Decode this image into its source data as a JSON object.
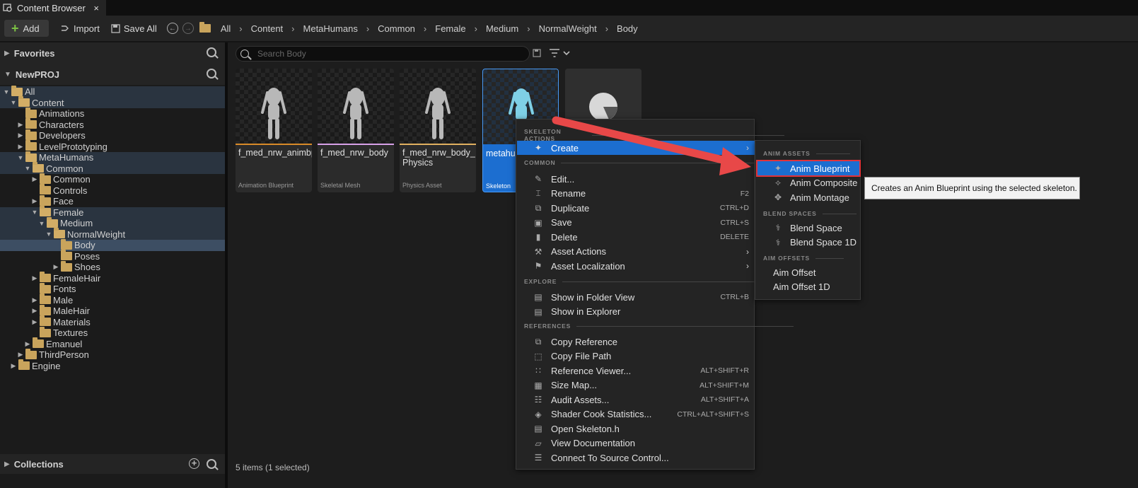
{
  "tab": {
    "title": "Content Browser",
    "close": "×"
  },
  "toolbar": {
    "add": "Add",
    "import": "Import",
    "save_all": "Save All",
    "breadcrumbs": [
      "All",
      "Content",
      "MetaHumans",
      "Common",
      "Female",
      "Medium",
      "NormalWeight",
      "Body"
    ]
  },
  "left": {
    "favorites": "Favorites",
    "project": "NewPROJ",
    "collections": "Collections",
    "tree": [
      {
        "label": "All",
        "indent": 0,
        "arrow": "down",
        "open": true,
        "state": "hl"
      },
      {
        "label": "Content",
        "indent": 1,
        "arrow": "down",
        "open": true,
        "state": "hl"
      },
      {
        "label": "Animations",
        "indent": 2,
        "arrow": "",
        "open": false,
        "state": ""
      },
      {
        "label": "Characters",
        "indent": 2,
        "arrow": "right",
        "open": false,
        "state": ""
      },
      {
        "label": "Developers",
        "indent": 2,
        "arrow": "right",
        "open": false,
        "state": ""
      },
      {
        "label": "LevelPrototyping",
        "indent": 2,
        "arrow": "right",
        "open": false,
        "state": ""
      },
      {
        "label": "MetaHumans",
        "indent": 2,
        "arrow": "down",
        "open": true,
        "state": "hl"
      },
      {
        "label": "Common",
        "indent": 3,
        "arrow": "down",
        "open": true,
        "state": "hl"
      },
      {
        "label": "Common",
        "indent": 4,
        "arrow": "right",
        "open": false,
        "state": ""
      },
      {
        "label": "Controls",
        "indent": 4,
        "arrow": "",
        "open": false,
        "state": ""
      },
      {
        "label": "Face",
        "indent": 4,
        "arrow": "right",
        "open": false,
        "state": ""
      },
      {
        "label": "Female",
        "indent": 4,
        "arrow": "down",
        "open": true,
        "state": "hl"
      },
      {
        "label": "Medium",
        "indent": 5,
        "arrow": "down",
        "open": true,
        "state": "hl"
      },
      {
        "label": "NormalWeight",
        "indent": 6,
        "arrow": "down",
        "open": true,
        "state": "hl"
      },
      {
        "label": "Body",
        "indent": 7,
        "arrow": "",
        "open": false,
        "state": "sel"
      },
      {
        "label": "Poses",
        "indent": 7,
        "arrow": "",
        "open": false,
        "state": ""
      },
      {
        "label": "Shoes",
        "indent": 7,
        "arrow": "right",
        "open": false,
        "state": ""
      },
      {
        "label": "FemaleHair",
        "indent": 4,
        "arrow": "right",
        "open": false,
        "state": ""
      },
      {
        "label": "Fonts",
        "indent": 4,
        "arrow": "",
        "open": false,
        "state": ""
      },
      {
        "label": "Male",
        "indent": 4,
        "arrow": "right",
        "open": false,
        "state": ""
      },
      {
        "label": "MaleHair",
        "indent": 4,
        "arrow": "right",
        "open": false,
        "state": ""
      },
      {
        "label": "Materials",
        "indent": 4,
        "arrow": "right",
        "open": false,
        "state": ""
      },
      {
        "label": "Textures",
        "indent": 4,
        "arrow": "",
        "open": false,
        "state": ""
      },
      {
        "label": "Emanuel",
        "indent": 3,
        "arrow": "right",
        "open": false,
        "state": ""
      },
      {
        "label": "ThirdPerson",
        "indent": 2,
        "arrow": "right",
        "open": false,
        "state": ""
      },
      {
        "label": "Engine",
        "indent": 1,
        "arrow": "right",
        "open": false,
        "state": ""
      }
    ]
  },
  "search": {
    "placeholder": "Search Body"
  },
  "assets": [
    {
      "name": "f_med_nrw_animbp",
      "type": "Animation Blueprint",
      "strip": "#d88a28",
      "selected": false
    },
    {
      "name": "f_med_nrw_body",
      "type": "Skeletal Mesh",
      "strip": "#d7a0e8",
      "selected": false
    },
    {
      "name": "f_med_nrw_body_ Physics",
      "type": "Physics Asset",
      "strip": "#e0b060",
      "selected": false
    },
    {
      "name": "metahuman_ skel",
      "type": "Skeleton",
      "strip": "#1c6ed0",
      "selected": true
    },
    {
      "name": "",
      "type": "",
      "strip": "",
      "selected": false
    }
  ],
  "status": "5 items (1 selected)",
  "menu": {
    "sections": [
      {
        "title": "SKELETON ACTIONS",
        "items": [
          {
            "label": "Create",
            "icon": "create-icon",
            "shortcut": "",
            "submenu": true,
            "active": true
          }
        ]
      },
      {
        "title": "COMMON",
        "items": [
          {
            "label": "Edit...",
            "icon": "edit-icon",
            "shortcut": "",
            "submenu": false,
            "active": false
          },
          {
            "label": "Rename",
            "icon": "rename-icon",
            "shortcut": "F2",
            "submenu": false,
            "active": false
          },
          {
            "label": "Duplicate",
            "icon": "duplicate-icon",
            "shortcut": "CTRL+D",
            "submenu": false,
            "active": false
          },
          {
            "label": "Save",
            "icon": "save-icon",
            "shortcut": "CTRL+S",
            "submenu": false,
            "active": false
          },
          {
            "label": "Delete",
            "icon": "delete-icon",
            "shortcut": "DELETE",
            "submenu": false,
            "active": false
          },
          {
            "label": "Asset Actions",
            "icon": "wrench-icon",
            "shortcut": "",
            "submenu": true,
            "active": false
          },
          {
            "label": "Asset Localization",
            "icon": "flag-icon",
            "shortcut": "",
            "submenu": true,
            "active": false
          }
        ]
      },
      {
        "title": "EXPLORE",
        "items": [
          {
            "label": "Show in Folder View",
            "icon": "folder-search-icon",
            "shortcut": "CTRL+B",
            "submenu": false,
            "active": false
          },
          {
            "label": "Show in Explorer",
            "icon": "explorer-icon",
            "shortcut": "",
            "submenu": false,
            "active": false
          }
        ]
      },
      {
        "title": "REFERENCES",
        "items": [
          {
            "label": "Copy Reference",
            "icon": "copy-icon",
            "shortcut": "",
            "submenu": false,
            "active": false
          },
          {
            "label": "Copy File Path",
            "icon": "copy-path-icon",
            "shortcut": "",
            "submenu": false,
            "active": false
          },
          {
            "label": "Reference Viewer...",
            "icon": "reference-viewer-icon",
            "shortcut": "ALT+SHIFT+R",
            "submenu": false,
            "active": false
          },
          {
            "label": "Size Map...",
            "icon": "size-map-icon",
            "shortcut": "ALT+SHIFT+M",
            "submenu": false,
            "active": false
          },
          {
            "label": "Audit Assets...",
            "icon": "audit-icon",
            "shortcut": "ALT+SHIFT+A",
            "submenu": false,
            "active": false
          },
          {
            "label": "Shader Cook Statistics...",
            "icon": "shader-icon",
            "shortcut": "CTRL+ALT+SHIFT+S",
            "submenu": false,
            "active": false
          },
          {
            "label": "Open Skeleton.h",
            "icon": "code-file-icon",
            "shortcut": "",
            "submenu": false,
            "active": false
          },
          {
            "label": "View Documentation",
            "icon": "book-icon",
            "shortcut": "",
            "submenu": false,
            "active": false
          },
          {
            "label": "Connect To Source Control...",
            "icon": "source-control-icon",
            "shortcut": "",
            "submenu": false,
            "active": false
          }
        ]
      }
    ]
  },
  "submenu": {
    "sections": [
      {
        "title": "ANIM ASSETS",
        "items": [
          {
            "label": "Anim Blueprint",
            "icon": "anim-blueprint-icon",
            "active": true
          },
          {
            "label": "Anim Composite",
            "icon": "anim-composite-icon",
            "active": false
          },
          {
            "label": "Anim Montage",
            "icon": "anim-montage-icon",
            "active": false
          }
        ]
      },
      {
        "title": "BLEND SPACES",
        "items": [
          {
            "label": "Blend Space",
            "icon": "blend-space-icon",
            "active": false
          },
          {
            "label": "Blend Space 1D",
            "icon": "blend-space-1d-icon",
            "active": false
          }
        ]
      },
      {
        "title": "AIM OFFSETS",
        "items": [
          {
            "label": "Aim Offset",
            "icon": "",
            "active": false
          },
          {
            "label": "Aim Offset 1D",
            "icon": "",
            "active": false
          }
        ]
      }
    ]
  },
  "tooltip": "Creates an Anim Blueprint using the selected skeleton.",
  "colors": {
    "accent": "#1c6ed0",
    "highlight_outline": "#e0333a",
    "arrow": "#e84848",
    "add_green": "#7cc144"
  }
}
